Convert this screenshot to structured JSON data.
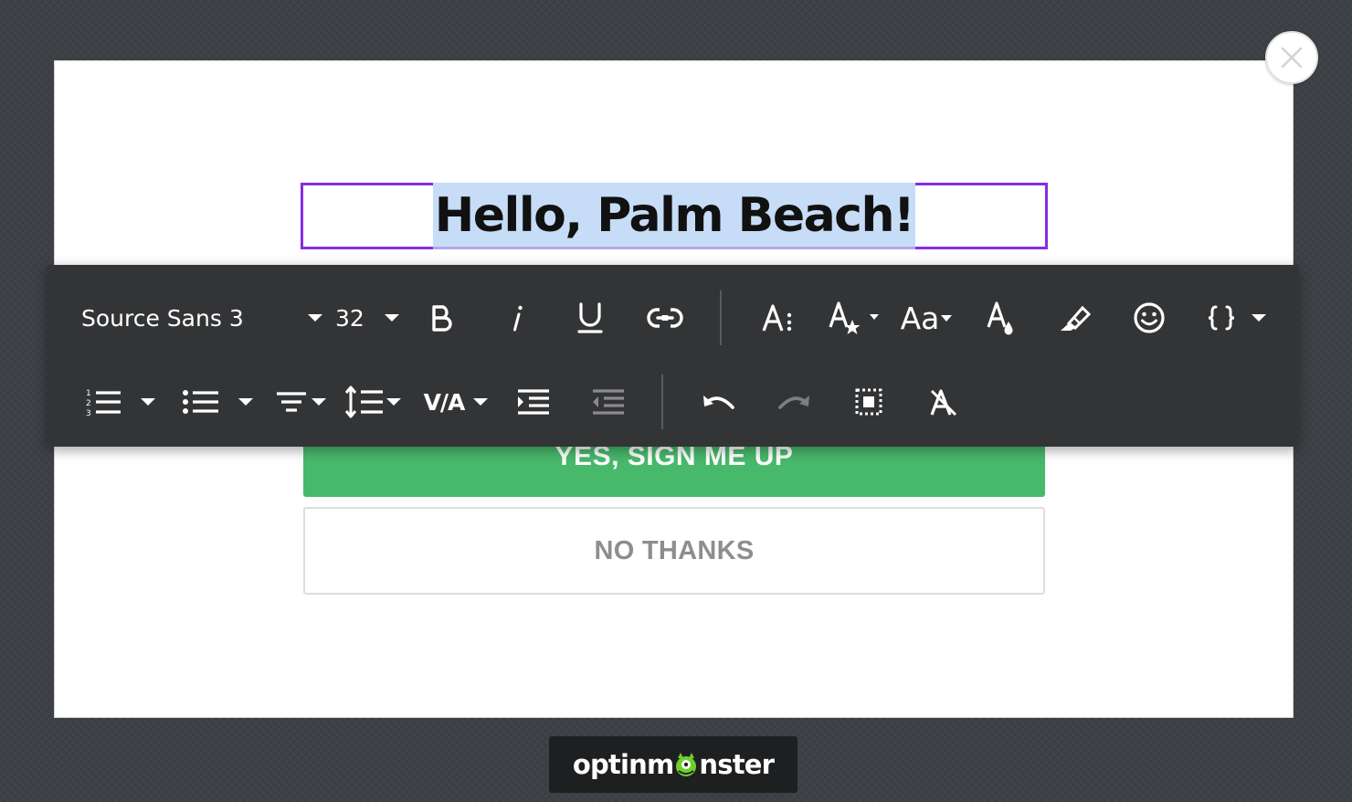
{
  "popup": {
    "headline": "Hello, Palm Beach!",
    "yes_button": "YES, SIGN ME UP",
    "no_button": "NO THANKS"
  },
  "toolbar": {
    "font_family": "Source Sans 3",
    "font_size": "32",
    "letter_spacing_label": "V/A",
    "case_label": "Aa",
    "icons": [
      "bold-icon",
      "italic-icon",
      "underline-icon",
      "link-icon",
      "line-height-icon",
      "special-characters-icon",
      "text-case-icon",
      "text-color-icon",
      "highlight-icon",
      "emoji-icon",
      "smart-tags-icon",
      "ordered-list-icon",
      "unordered-list-icon",
      "text-align-icon",
      "line-spacing-icon",
      "letter-spacing-icon",
      "indent-icon",
      "outdent-icon",
      "undo-icon",
      "redo-icon",
      "select-all-icon",
      "clear-formatting-icon"
    ]
  },
  "branding": {
    "logo_prefix": "optinm",
    "logo_suffix": "nster"
  },
  "colors": {
    "accent": "#8a2be2",
    "selection": "#c6dcf7",
    "yes_button": "#48b86b",
    "toolbar_bg": "#333436"
  }
}
